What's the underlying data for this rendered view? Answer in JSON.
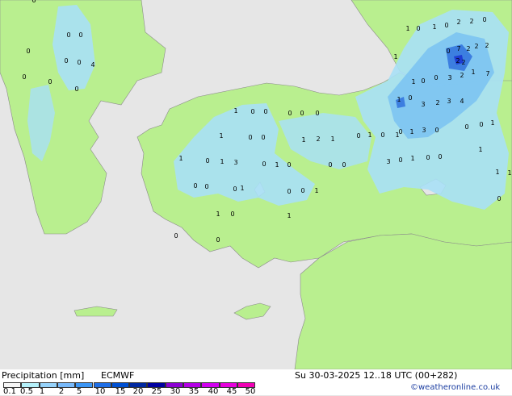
{
  "title_left": "Precipitation [mm]",
  "model": "ECMWF",
  "valid_time": "Su 30-03-2025 12..18 UTC (00+282)",
  "credit": "©weatheronline.co.uk",
  "legend": {
    "ticks": [
      "0.1",
      "0.5",
      "1",
      "2",
      "5",
      "10",
      "15",
      "20",
      "25",
      "30",
      "35",
      "40",
      "45",
      "50"
    ],
    "colors": [
      "#f5f5f5",
      "#b4f0fa",
      "#96d2fa",
      "#78b9fa",
      "#3c96f5",
      "#1e6ee6",
      "#0050d2",
      "#0028a0",
      "#0000a0",
      "#8c00d2",
      "#b400e6",
      "#d200f0",
      "#e600dc",
      "#f000b4"
    ]
  },
  "colors": {
    "land": "#b9ef8f",
    "sea": "#e6e6e6",
    "light_rain": "#a8e0f6",
    "moderate_rain": "#7cc4f2",
    "heavy_rain": "#3c7ee0",
    "peak_rain": "#1e3cd2"
  },
  "map_values": [
    {
      "text": "0"
    },
    {
      "text": "0"
    },
    {
      "text": "0"
    },
    {
      "text": "0"
    },
    {
      "text": "0"
    },
    {
      "text": "4"
    },
    {
      "text": "0"
    },
    {
      "text": "0"
    },
    {
      "text": "0"
    },
    {
      "text": "0"
    },
    {
      "text": "1"
    },
    {
      "text": "0"
    },
    {
      "text": "1"
    },
    {
      "text": "0"
    },
    {
      "text": "2"
    },
    {
      "text": "2"
    },
    {
      "text": "0"
    },
    {
      "text": "1"
    },
    {
      "text": "0"
    },
    {
      "text": "7"
    },
    {
      "text": "2"
    },
    {
      "text": "2"
    },
    {
      "text": "2"
    },
    {
      "text": "2"
    },
    {
      "text": "2"
    },
    {
      "text": "1"
    },
    {
      "text": "7"
    },
    {
      "text": "1"
    },
    {
      "text": "0"
    },
    {
      "text": "0"
    },
    {
      "text": "3"
    },
    {
      "text": "2"
    },
    {
      "text": "1"
    },
    {
      "text": "0"
    },
    {
      "text": "3"
    },
    {
      "text": "2"
    },
    {
      "text": "3"
    },
    {
      "text": "4"
    },
    {
      "text": "1"
    },
    {
      "text": "0"
    },
    {
      "text": "0"
    },
    {
      "text": "0"
    },
    {
      "text": "0"
    },
    {
      "text": "0"
    },
    {
      "text": "0"
    },
    {
      "text": "1"
    },
    {
      "text": "3"
    },
    {
      "text": "0"
    },
    {
      "text": "0"
    },
    {
      "text": "0"
    },
    {
      "text": "1"
    },
    {
      "text": "1"
    },
    {
      "text": "0"
    },
    {
      "text": "0"
    },
    {
      "text": "1"
    },
    {
      "text": "2"
    },
    {
      "text": "1"
    },
    {
      "text": "0"
    },
    {
      "text": "1"
    },
    {
      "text": "0"
    },
    {
      "text": "1"
    },
    {
      "text": "1"
    },
    {
      "text": "0"
    },
    {
      "text": "1"
    },
    {
      "text": "3"
    },
    {
      "text": "0"
    },
    {
      "text": "1"
    },
    {
      "text": "0"
    },
    {
      "text": "0"
    },
    {
      "text": "0"
    },
    {
      "text": "3"
    },
    {
      "text": "0"
    },
    {
      "text": "1"
    },
    {
      "text": "0"
    },
    {
      "text": "0"
    },
    {
      "text": "1"
    },
    {
      "text": "1"
    },
    {
      "text": "1"
    },
    {
      "text": "0"
    },
    {
      "text": "0"
    },
    {
      "text": "0"
    },
    {
      "text": "1"
    },
    {
      "text": "0"
    },
    {
      "text": "0"
    },
    {
      "text": "1"
    },
    {
      "text": "0"
    },
    {
      "text": "1"
    },
    {
      "text": "0"
    },
    {
      "text": "0"
    },
    {
      "text": "0"
    },
    {
      "text": "1"
    }
  ]
}
